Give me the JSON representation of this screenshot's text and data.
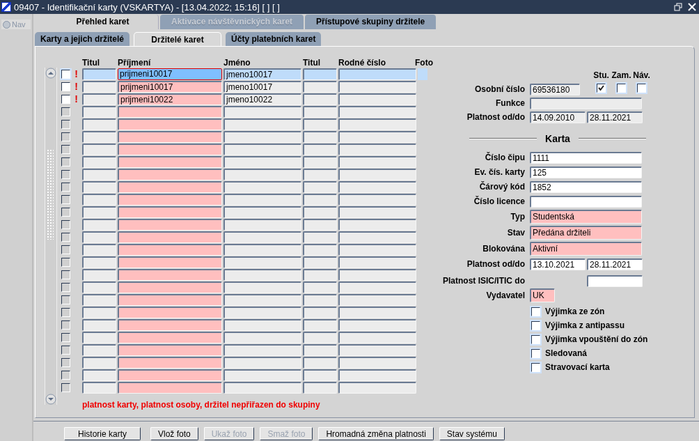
{
  "window": {
    "title": "09407 - Identifikační karty (VSKARTYA) - [13.04.2022; 15:16] [ ] [ ]"
  },
  "nav": {
    "label": "Nav",
    "selected": false
  },
  "tabs": [
    {
      "label": "Přehled karet",
      "selected": true,
      "disabled": false
    },
    {
      "label": "Aktivace návštěvnických karet",
      "selected": false,
      "disabled": true
    },
    {
      "label": "Přístupové skupiny držitele",
      "selected": false,
      "disabled": false
    }
  ],
  "subtabs": [
    {
      "label": "Karty a jejich držitelé",
      "selected": false
    },
    {
      "label": "Držitelé karet",
      "selected": true
    },
    {
      "label": "Účty platebních karet",
      "selected": false
    }
  ],
  "table": {
    "columns": [
      "Titul",
      "Příjmení",
      "Jméno",
      "Titul",
      "Rodné číslo",
      "Foto"
    ],
    "rows": [
      {
        "selected": true,
        "checked": false,
        "disabled": false,
        "flag": "!",
        "prijmeni": "prijmeni10017",
        "jmeno": "jmeno10017"
      },
      {
        "selected": false,
        "checked": false,
        "disabled": false,
        "flag": "!",
        "prijmeni": "prijmeni10017",
        "jmeno": "jmeno10017"
      },
      {
        "selected": false,
        "checked": false,
        "disabled": false,
        "flag": "!",
        "prijmeni": "prijmeni10022",
        "jmeno": "jmeno10022"
      },
      {
        "selected": false,
        "checked": false,
        "disabled": true
      },
      {
        "selected": false,
        "checked": false,
        "disabled": true
      },
      {
        "selected": false,
        "checked": false,
        "disabled": true
      },
      {
        "selected": false,
        "checked": false,
        "disabled": true
      },
      {
        "selected": false,
        "checked": false,
        "disabled": true
      },
      {
        "selected": false,
        "checked": false,
        "disabled": true
      },
      {
        "selected": false,
        "checked": false,
        "disabled": true
      },
      {
        "selected": false,
        "checked": false,
        "disabled": true
      },
      {
        "selected": false,
        "checked": false,
        "disabled": true
      },
      {
        "selected": false,
        "checked": false,
        "disabled": true
      },
      {
        "selected": false,
        "checked": false,
        "disabled": true
      },
      {
        "selected": false,
        "checked": false,
        "disabled": true
      },
      {
        "selected": false,
        "checked": false,
        "disabled": true
      },
      {
        "selected": false,
        "checked": false,
        "disabled": true
      },
      {
        "selected": false,
        "checked": false,
        "disabled": true
      },
      {
        "selected": false,
        "checked": false,
        "disabled": true
      },
      {
        "selected": false,
        "checked": false,
        "disabled": true
      },
      {
        "selected": false,
        "checked": false,
        "disabled": true
      },
      {
        "selected": false,
        "checked": false,
        "disabled": true
      },
      {
        "selected": false,
        "checked": false,
        "disabled": true
      },
      {
        "selected": false,
        "checked": false,
        "disabled": true
      },
      {
        "selected": false,
        "checked": false,
        "disabled": true
      },
      {
        "selected": false,
        "checked": false,
        "disabled": true
      }
    ],
    "message": "platnost karty, platnost osoby, držitel nepřiřazen do skupiny"
  },
  "person": {
    "roles": [
      {
        "label": "Stu.",
        "checked": true
      },
      {
        "label": "Zam.",
        "checked": false
      },
      {
        "label": "Náv.",
        "checked": false
      }
    ],
    "fields": [
      {
        "label": "Osobní číslo",
        "kind": "short",
        "value": "69536180"
      },
      {
        "label": "Funkce",
        "kind": "wide"
      },
      {
        "label": "Platnost od/do",
        "kind": "date_pair",
        "from": "14.09.2010",
        "to": "28.11.2021"
      }
    ]
  },
  "card": {
    "title": "Karta",
    "fields": [
      {
        "label": "Číslo čipu",
        "kind": "wide",
        "required": false,
        "value": "1111"
      },
      {
        "label": "Ev. čís. karty",
        "kind": "wide",
        "required": false,
        "value": "125"
      },
      {
        "label": "Čárový kód",
        "kind": "wide",
        "required": false,
        "value": "1852"
      },
      {
        "label": "Číslo licence",
        "kind": "wide",
        "required": false
      },
      {
        "label": "Typ",
        "kind": "wide",
        "required": true,
        "value": "Studentská"
      },
      {
        "label": "Stav",
        "kind": "wide",
        "required": true,
        "value": "Předána držiteli"
      },
      {
        "label": "Blokována",
        "kind": "wide",
        "required": true,
        "value": "Aktivní"
      },
      {
        "label": "Platnost od/do",
        "kind": "date_pair",
        "required": false,
        "from": "13.10.2021",
        "to": "28.11.2021"
      },
      {
        "label": "Platnost ISIC/ITIC do",
        "kind": "second_only",
        "required": false
      },
      {
        "label": "Vydavatel",
        "kind": "short",
        "required": true,
        "value": "UK"
      }
    ],
    "flags": [
      {
        "label": "Výjimka ze zón",
        "checked": false
      },
      {
        "label": "Výjimka z antipassu",
        "checked": false
      },
      {
        "label": "Výjimka vpouštění do zón",
        "checked": false
      },
      {
        "label": "Sledovaná",
        "checked": false
      },
      {
        "label": "Stravovací karta",
        "checked": false
      }
    ]
  },
  "buttons": [
    {
      "label": "Historie karty",
      "disabled": false
    },
    {
      "label": "Vlož foto",
      "disabled": false
    },
    {
      "label": "Ukaž foto",
      "disabled": true
    },
    {
      "label": "Smaž foto",
      "disabled": true
    },
    {
      "label": "Hromadná změna platnosti",
      "disabled": false
    },
    {
      "label": "Stav systému",
      "disabled": false
    }
  ]
}
